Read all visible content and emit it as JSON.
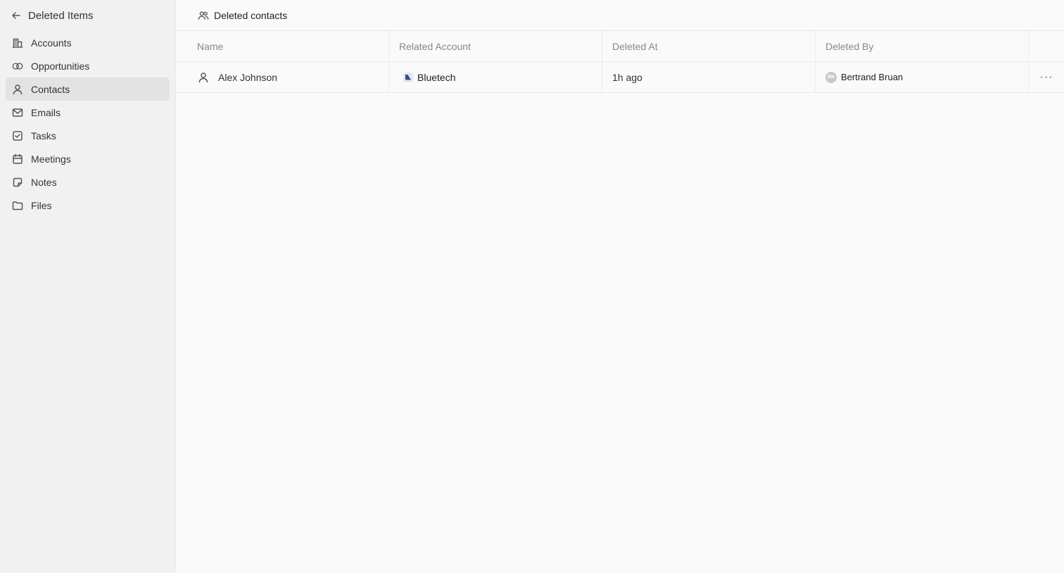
{
  "sidebar": {
    "header_title": "Deleted Items",
    "items": [
      {
        "label": "Accounts",
        "icon": "building-icon"
      },
      {
        "label": "Opportunities",
        "icon": "target-icon"
      },
      {
        "label": "Contacts",
        "icon": "user-icon",
        "active": true
      },
      {
        "label": "Emails",
        "icon": "mail-icon"
      },
      {
        "label": "Tasks",
        "icon": "checkbox-icon"
      },
      {
        "label": "Meetings",
        "icon": "calendar-icon"
      },
      {
        "label": "Notes",
        "icon": "note-icon"
      },
      {
        "label": "Files",
        "icon": "folder-icon"
      }
    ]
  },
  "header": {
    "title": "Deleted contacts",
    "icon": "users-icon"
  },
  "table": {
    "columns": [
      "Name",
      "Related Account",
      "Deleted At",
      "Deleted By"
    ],
    "rows": [
      {
        "name": "Alex Johnson",
        "related_account": "Bluetech",
        "deleted_at": "1h ago",
        "deleted_by": "Bertrand Bruan",
        "deleted_by_initials": "BB"
      }
    ]
  },
  "colors": {
    "sidebar_bg": "#f1f1f1",
    "active_item_bg": "#e3e3e3",
    "main_bg": "#fafafa",
    "header_text": "#888888"
  }
}
